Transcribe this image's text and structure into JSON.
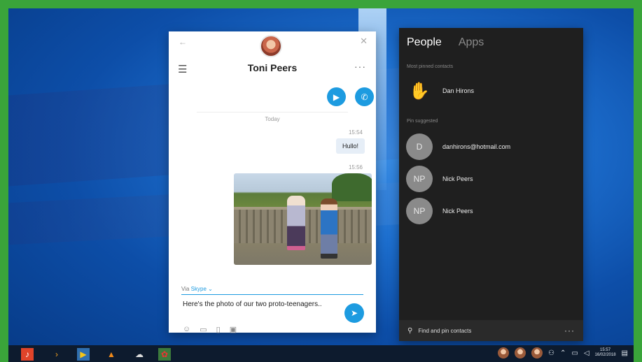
{
  "skype": {
    "contact_name": "Toni Peers",
    "date_divider": "Today",
    "messages": [
      {
        "time": "15:54",
        "text": "Hullo!"
      },
      {
        "time": "15:56",
        "text": ""
      }
    ],
    "via_prefix": "Via",
    "via_service": "Skype",
    "compose_text": "Here's the photo of our two proto-teenagers.."
  },
  "people": {
    "tabs": [
      "People",
      "Apps"
    ],
    "pinned_header": "Most pinned contacts",
    "suggested_header": "Pin suggested",
    "contacts": [
      {
        "initials": "",
        "name": "Dan Hirons"
      },
      {
        "initials": "D",
        "name": "danhirons@hotmail.com"
      },
      {
        "initials": "NP",
        "name": "Nick Peers"
      },
      {
        "initials": "NP",
        "name": "Nick Peers"
      }
    ],
    "footer_label": "Find and pin contacts"
  },
  "taskbar": {
    "time": "15:57",
    "date": "16/02/2018"
  },
  "colors": {
    "frame": "#3aa43a",
    "skype_blue": "#1d9be0",
    "people_bg": "#1f1f1f"
  }
}
